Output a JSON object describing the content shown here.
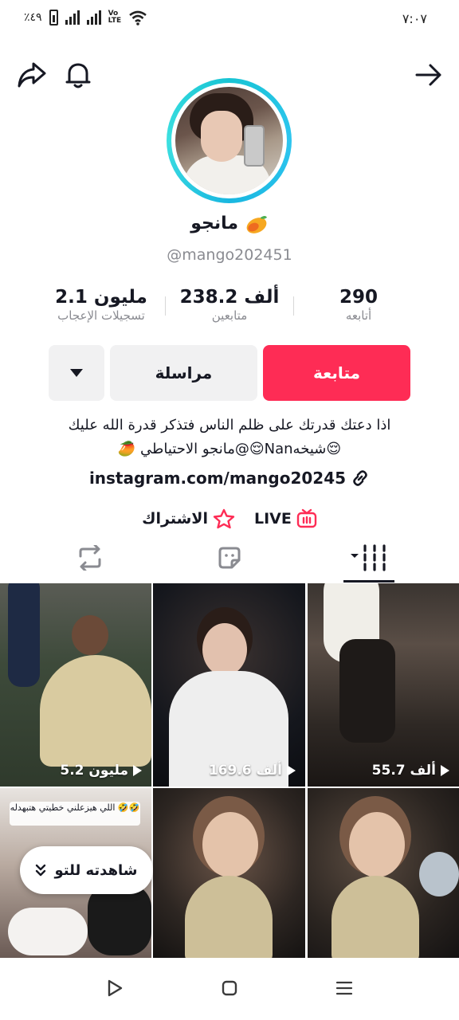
{
  "status_bar": {
    "battery_text": "٪٤٩",
    "volte_label": "VoLTE",
    "time": "٧:٠٧"
  },
  "topbar": {
    "back_icon": "arrow-right-icon",
    "notifications_icon": "bell-icon",
    "share_icon": "share-arrow-icon"
  },
  "profile": {
    "display_name": "مانجو",
    "name_emoji": "mango-emoji",
    "username": "@mango202451",
    "ring_color": "#18c4d4"
  },
  "stats": {
    "following": {
      "value": "290",
      "label": "أتابعه"
    },
    "followers": {
      "value": "238.2 ألف",
      "label": "متابعين"
    },
    "likes": {
      "value": "2.1 مليون",
      "label": "تسجيلات الإعجاب"
    }
  },
  "actions": {
    "follow_label": "متابعة",
    "message_label": "مراسلة",
    "follow_color": "#fe2c55"
  },
  "bio": {
    "line1": "اذا دعتك قدرتك على ظلم الناس فتذكر قدرة الله عليك",
    "line2": "😌شيخهNan😌@مانجو الاحتياطي 🥭",
    "link": "instagram.com/mango20245"
  },
  "extras": {
    "live_label": "LIVE",
    "subscribe_label": "الاشتراك"
  },
  "tabs": [
    {
      "name": "videos",
      "icon": "grid-icon",
      "active": true
    },
    {
      "name": "favorites",
      "icon": "sticker-icon",
      "active": false
    },
    {
      "name": "reposts",
      "icon": "repost-icon",
      "active": false
    }
  ],
  "grid": {
    "videos": [
      {
        "views": "55.7 ألف"
      },
      {
        "views": "169.6 ألف"
      },
      {
        "views": "5.2 مليون"
      }
    ],
    "caption_text": "اللي هيزعلني خطيتي هتبهدله 🤣🤣",
    "watched_label": "شاهدته للتو"
  },
  "navbar": {
    "recents_icon": "menu-lines-icon",
    "home_icon": "square-icon",
    "back_icon": "triangle-back-icon"
  }
}
